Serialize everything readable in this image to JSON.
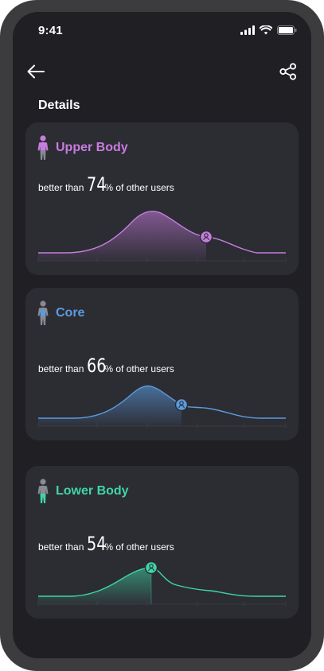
{
  "status_bar": {
    "time": "9:41"
  },
  "nav": {
    "back_icon": "arrow-left-icon",
    "share_icon": "share-icon"
  },
  "section_title": "Details",
  "stat_text": {
    "prefix": "better than",
    "suffix": "% of other users"
  },
  "cards": [
    {
      "title": "Upper Body",
      "value": "74",
      "percentile": 74,
      "accent": "#c77ddf",
      "icon": "upper-body-figure-icon"
    },
    {
      "title": "Core",
      "value": "66",
      "percentile": 66,
      "accent": "#5b9be0",
      "icon": "core-figure-icon"
    },
    {
      "title": "Lower Body",
      "value": "54",
      "percentile": 54,
      "accent": "#3fd6a6",
      "icon": "lower-body-figure-icon"
    }
  ],
  "colors": {
    "background": "#1f1f24",
    "card": "#2c2c33",
    "frame": "#3c3c3e",
    "text": "#ffffff"
  }
}
